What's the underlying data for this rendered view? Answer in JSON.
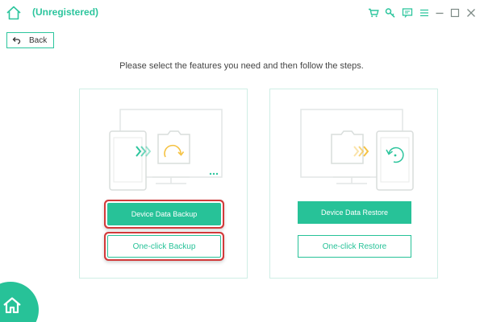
{
  "app": {
    "title": "(Unregistered)"
  },
  "toolbar": {
    "icons": [
      "cart-icon",
      "key-icon",
      "feedback-icon",
      "menu-icon",
      "minimize-icon",
      "maximize-icon",
      "close-icon"
    ]
  },
  "nav": {
    "back_label": "Back"
  },
  "main": {
    "instruction": "Please select the features you need and then follow the steps.",
    "backup": {
      "primary_label": "Device Data Backup",
      "secondary_label": "One-click Backup"
    },
    "restore": {
      "primary_label": "Device Data Restore",
      "secondary_label": "One-click Restore"
    }
  },
  "colors": {
    "accent": "#27c298",
    "title_green": "#2cc59d",
    "highlight_red": "#d23a3a",
    "arrow_backup": "#2cc59d",
    "arrow_restore": "#f5c242"
  }
}
